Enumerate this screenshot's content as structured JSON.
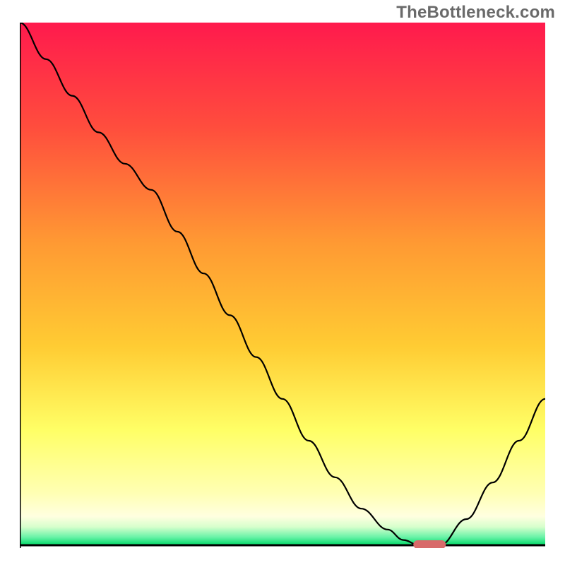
{
  "watermark": "TheBottleneck.com",
  "colors": {
    "gradient_top": "#ff1a4d",
    "gradient_mid_upper": "#ff7a33",
    "gradient_mid": "#ffd633",
    "gradient_lower": "#ffff80",
    "gradient_pale": "#ffffe0",
    "gradient_green": "#00e673",
    "curve": "#000000",
    "axis": "#000000",
    "marker": "#d86a6a",
    "watermark_text": "#6a6a6a"
  },
  "chart_data": {
    "type": "line",
    "title": "",
    "xlabel": "",
    "ylabel": "",
    "xlim": [
      0,
      100
    ],
    "ylim": [
      0,
      100
    ],
    "x": [
      0,
      5,
      10,
      15,
      20,
      25,
      30,
      35,
      40,
      45,
      50,
      55,
      60,
      65,
      70,
      73,
      76,
      80,
      85,
      90,
      95,
      100
    ],
    "values": [
      100,
      93,
      86,
      79,
      73,
      68,
      60,
      52,
      44,
      36,
      28,
      20,
      13,
      7,
      3,
      1,
      0,
      0,
      5,
      12,
      20,
      28
    ],
    "optimal_x": 78,
    "optimal_y": 0,
    "annotations": []
  }
}
